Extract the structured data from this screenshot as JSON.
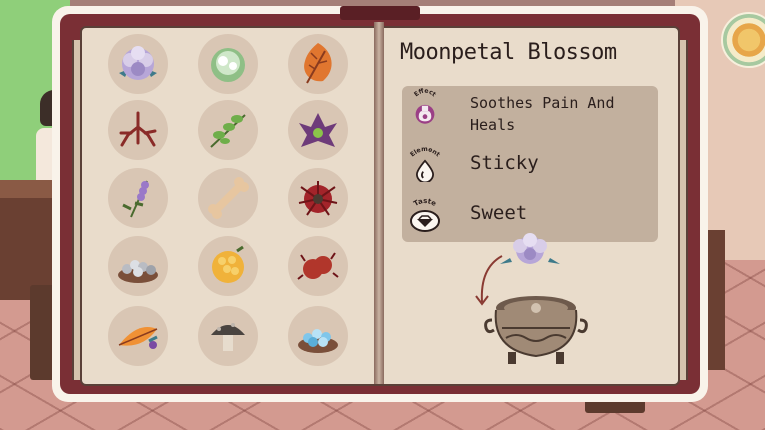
{
  "book": {
    "ingredients": [
      {
        "name": "moonpetal-blossom-icon",
        "color": "#b7a6d8"
      },
      {
        "name": "white-cabbage-flower-icon",
        "color": "#cfe7c9"
      },
      {
        "name": "autumn-leaf-icon",
        "color": "#e0762f"
      },
      {
        "name": "red-root-icon",
        "color": "#8a2b28"
      },
      {
        "name": "green-vine-icon",
        "color": "#6fae4a"
      },
      {
        "name": "purple-flower-icon",
        "color": "#6e3b7a"
      },
      {
        "name": "lavender-sprig-icon",
        "color": "#9a79c8"
      },
      {
        "name": "bone-icon",
        "color": "#e7c6a0"
      },
      {
        "name": "red-spider-flower-icon",
        "color": "#a3242a"
      },
      {
        "name": "silver-pebbles-bowl-icon",
        "color": "#b9bcc3"
      },
      {
        "name": "golden-berries-icon",
        "color": "#f0b23a"
      },
      {
        "name": "red-crab-berries-icon",
        "color": "#b1362b"
      },
      {
        "name": "orange-feather-icon",
        "color": "#f09135"
      },
      {
        "name": "dark-mushroom-icon",
        "color": "#4a4440"
      },
      {
        "name": "blue-crystal-bowl-icon",
        "color": "#7fc6ea"
      }
    ],
    "detail": {
      "title": "Moonpetal Blossom",
      "effect_tag": "Effect",
      "effect_text": "Soothes Pain And Heals",
      "element_tag": "Element",
      "element_text": "Sticky",
      "taste_tag": "Taste",
      "taste_text": "Sweet"
    }
  },
  "colors": {
    "book_cover": "#7a2f35",
    "page": "#e9dccb",
    "panel": "#c2b09e",
    "text": "#2a1e1c"
  }
}
